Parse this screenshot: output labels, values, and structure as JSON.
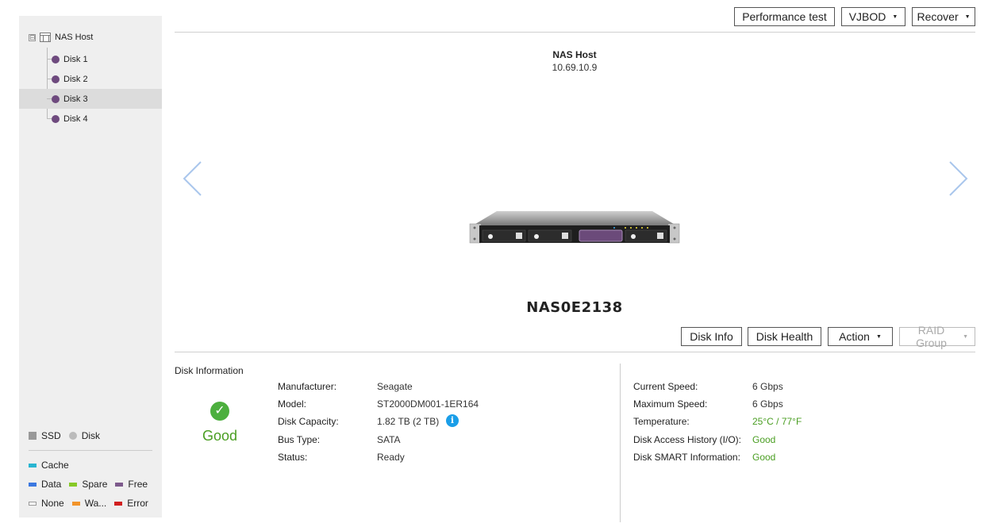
{
  "sidebar": {
    "root": {
      "label": "NAS Host",
      "toggle": "⊟"
    },
    "disks": [
      {
        "label": "Disk 1",
        "selected": false
      },
      {
        "label": "Disk 2",
        "selected": false
      },
      {
        "label": "Disk 3",
        "selected": true
      },
      {
        "label": "Disk 4",
        "selected": false
      }
    ],
    "legend": {
      "ssd": "SSD",
      "disk": "Disk",
      "cache": "Cache",
      "data": "Data",
      "spare": "Spare",
      "free": "Free",
      "none": "None",
      "warning": "Wa...",
      "error": "Error"
    },
    "colors": {
      "cache": "#29b5d1",
      "data": "#3b78e0",
      "spare": "#86c926",
      "free": "#7d5a8c",
      "none": "#ffffff",
      "warning": "#f2942a",
      "error": "#d11f1f",
      "disk_dot": "#6e4a7e"
    }
  },
  "toolbar": {
    "performance_test": "Performance test",
    "vjbod": "VJBOD",
    "recover": "Recover"
  },
  "host": {
    "name": "NAS Host",
    "ip": "10.69.10.9",
    "device_name": "NAS0E2138"
  },
  "actions": {
    "disk_info": "Disk Info",
    "disk_health": "Disk Health",
    "action": "Action",
    "raid_group": "RAID Group"
  },
  "disk_info": {
    "title": "Disk Information",
    "status_summary": "Good",
    "left": [
      {
        "label": "Manufacturer:",
        "value": "Seagate"
      },
      {
        "label": "Model:",
        "value": "ST2000DM001-1ER164"
      },
      {
        "label": "Disk Capacity:",
        "value": "1.82 TB (2 TB)"
      },
      {
        "label": "Bus Type:",
        "value": "SATA"
      },
      {
        "label": "Status:",
        "value": "Ready"
      }
    ],
    "right": [
      {
        "label": "Current Speed:",
        "value": "6 Gbps"
      },
      {
        "label": "Maximum Speed:",
        "value": "6 Gbps"
      },
      {
        "label": "Temperature:",
        "value": "25°C / 77°F"
      },
      {
        "label": "Disk Access History (I/O):",
        "value": "Good"
      },
      {
        "label": "Disk SMART Information:",
        "value": "Good"
      }
    ]
  }
}
